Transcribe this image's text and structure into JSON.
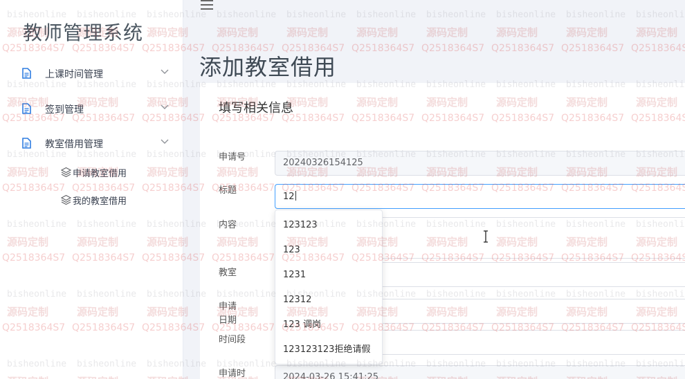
{
  "sidebar": {
    "app_title": "教师管理系统",
    "groups": [
      {
        "label": "上课时间管理",
        "icon": "document-icon"
      },
      {
        "label": "签到管理",
        "icon": "document-icon"
      },
      {
        "label": "教室借用管理",
        "icon": "document-icon"
      }
    ],
    "sub_items": [
      {
        "label": "申请教室借用",
        "icon": "layers-icon"
      },
      {
        "label": "我的教室借用",
        "icon": "layers-icon"
      }
    ]
  },
  "header": {
    "menu_icon": "hamburger-icon",
    "page_title": "添加教室借用"
  },
  "form": {
    "section_title": "填写相关信息",
    "fields": {
      "application_no": {
        "label": "申请号",
        "value": "20240326154125"
      },
      "title": {
        "label": "标题",
        "value": "12"
      },
      "content": {
        "label": "内容",
        "value": ""
      },
      "classroom": {
        "label": "教室",
        "value": ""
      },
      "apply_date": {
        "label": "申请日期",
        "value": ""
      },
      "time_slot": {
        "label": "时间段",
        "value": ""
      },
      "apply_time": {
        "label": "申请时",
        "value": "2024-03-26 15:41:25"
      }
    }
  },
  "autocomplete": {
    "options": [
      "123123",
      "123",
      "1231",
      "12312",
      "123 调岗",
      "123123123拒绝请假"
    ]
  },
  "watermark": {
    "text_a": "bisheonline",
    "text_b": "源码定制",
    "text_c": "Q2518364S7"
  },
  "colors": {
    "focus_border": "#409eff",
    "main_bg": "#f1f3f8",
    "icon_blue": "#2f7de1"
  }
}
